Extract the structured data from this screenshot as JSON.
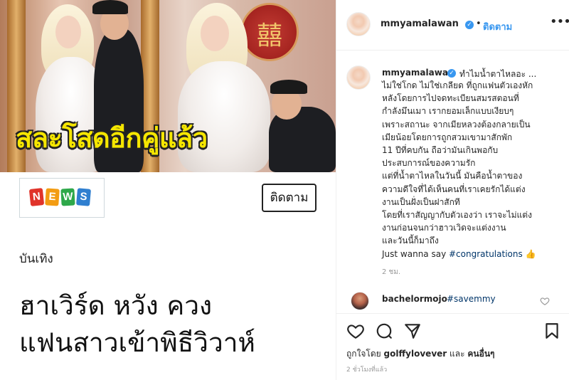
{
  "image": {
    "headline": "สละโสดอีกคู่แล้ว"
  },
  "article": {
    "news_logo": [
      "N",
      "E",
      "W",
      "S"
    ],
    "news_logo_colors": [
      "#e0332a",
      "#f39c12",
      "#2ea84a",
      "#2f7fd0"
    ],
    "follow_label": "ติดตาม",
    "category": "บันเทิง",
    "title_line1": "ฮาเวิร์ด หวัง ควง",
    "title_line2": "แฟนสาวเข้าพิธีวิวาห์"
  },
  "post_header": {
    "username": "mmyamalawan",
    "separator": "•",
    "follow_label": "ติดตาม",
    "more_icon": "more-horizontal-icon"
  },
  "caption": {
    "username": "mmyamalawan",
    "first_line": "ทำไมน้ำตาไหลอะ ...",
    "lines": [
      "ไม่ใช่โกด ไม่ใช่เกลียด ที่ถูกแฟนตัวเองหัก",
      "หลังโดยการไปจดทะเบียนสมรสตอนที่",
      "กำลังมึนเมา เรากยอมเล็กแบบเงียบๆ",
      "เพราะสถานะ จากเมียหลวงต้องกลายเป็น",
      "เมียน้อยโดยการถูกสวมเขามาสักพัก",
      "11 ปีที่คบกัน ถือว่ามันเกินพอกับ",
      "ประสบการณ์ของความรัก",
      "แต่ที่น้ำตาไหลในวันนี้ มันคือน้ำตาของ",
      "ความดีใจที่ได้เห็นคนที่เราเคยรักได้แต่ง",
      "งานเป็นฝั่งเป็นฝาสักที",
      "โดยที่เราสัญญากับตัวเองว่า เราจะไม่แต่ง",
      "งานก่อนจนกว่าฮาวเวิดจะแต่งงาน",
      "และวันนี้ก็มาถึง"
    ],
    "last_prefix": "Just wanna say ",
    "last_hashtag": "#congratulations",
    "last_emoji": "👍",
    "time": "2 ชม."
  },
  "comment": {
    "username": "bachelormojo",
    "hashtag": "#savemmy",
    "heart_icon": "heart-outline-icon"
  },
  "actions": {
    "icons": [
      "heart-icon",
      "comment-icon",
      "share-icon",
      "bookmark-icon"
    ],
    "likes_prefix": "ถูกใจโดย ",
    "likes_user": "golffylovever",
    "likes_middle": " และ ",
    "likes_others": "คนอื่นๆ",
    "post_time": "2 ชั่วโมงที่แล้ว"
  },
  "colors": {
    "link_blue": "#3897f0",
    "hashtag": "#003569",
    "headline_yellow": "#f5e600"
  }
}
